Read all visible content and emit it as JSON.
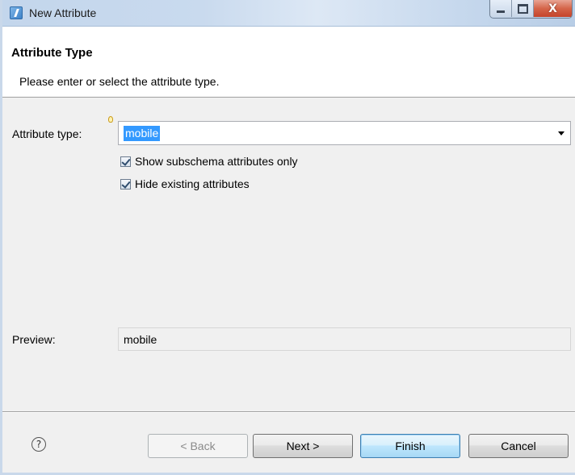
{
  "window": {
    "title": "New Attribute",
    "icon": "wizard-app-icon",
    "controls": {
      "minimize_icon": "minimize-icon",
      "maximize_icon": "maximize-icon",
      "close_label": "X"
    }
  },
  "header": {
    "title": "Attribute Type",
    "description": "Please enter or select the attribute type."
  },
  "form": {
    "attribute_type_label": "Attribute type:",
    "attribute_type_value": "mobile",
    "hint_icon": "lightbulb-icon",
    "checkboxes": [
      {
        "label": "Show subschema attributes only",
        "checked": true
      },
      {
        "label": "Hide existing attributes",
        "checked": true
      }
    ],
    "preview_label": "Preview:",
    "preview_value": "mobile"
  },
  "footer": {
    "help_icon": "help-icon",
    "help_glyph": "?",
    "buttons": {
      "back": {
        "label": "< Back",
        "enabled": false
      },
      "next": {
        "label": "Next >",
        "enabled": true
      },
      "finish": {
        "label": "Finish",
        "enabled": true,
        "default": true
      },
      "cancel": {
        "label": "Cancel",
        "enabled": true
      }
    }
  },
  "colors": {
    "selection": "#3399ff",
    "dialog_background": "#f0f0f0",
    "close_button": "#c4432a"
  }
}
